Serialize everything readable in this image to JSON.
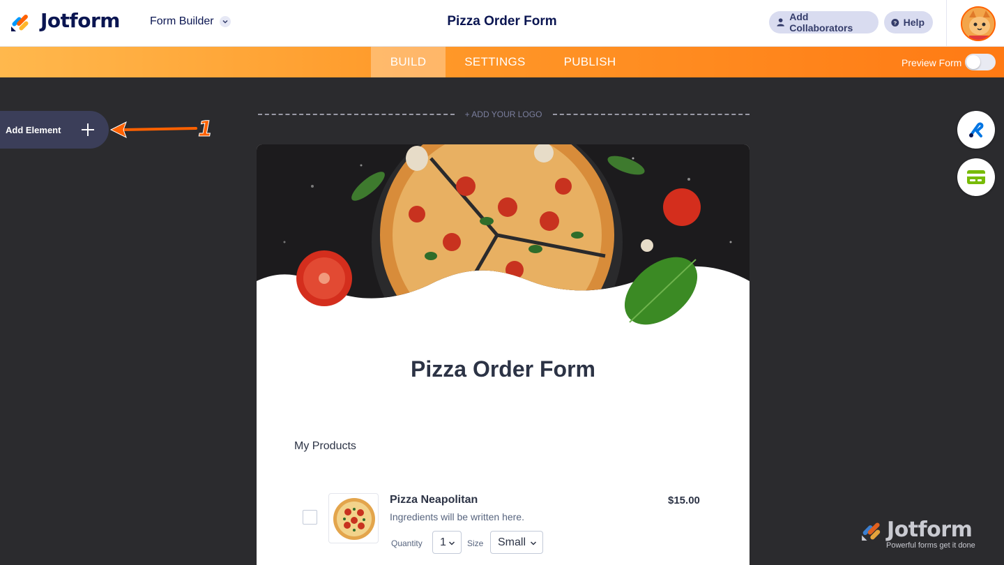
{
  "header": {
    "brand": "Jotform",
    "builder_menu": "Form Builder",
    "form_title": "Pizza Order Form",
    "add_collaborators": "Add Collaborators",
    "help": "Help"
  },
  "nav": {
    "tabs": [
      {
        "label": "BUILD",
        "active": true
      },
      {
        "label": "SETTINGS",
        "active": false
      },
      {
        "label": "PUBLISH",
        "active": false
      }
    ],
    "preview_label": "Preview Form",
    "preview_on": false
  },
  "sidebar": {
    "add_element": "Add Element",
    "annotation_number": "1"
  },
  "form": {
    "add_logo": "+ ADD YOUR LOGO",
    "title": "Pizza Order Form",
    "section_label": "My Products",
    "product": {
      "name": "Pizza Neapolitan",
      "description": "Ingredients will be written here.",
      "price": "$15.00",
      "quantity_label": "Quantity",
      "quantity_value": "1",
      "size_label": "Size",
      "size_value": "Small"
    }
  },
  "watermark": {
    "brand": "Jotform",
    "tagline": "Powerful forms get it done"
  },
  "colors": {
    "brand_navy": "#0a1551",
    "accent_orange": "#ff6100",
    "canvas_dark": "#2b2b2e",
    "tab_panel": "#3b3e59"
  },
  "icons": [
    "jotform-logo-icon",
    "chevron-down-icon",
    "user-icon",
    "question-icon",
    "plus-icon",
    "arrow-icon",
    "paint-roller-icon",
    "payment-card-icon"
  ]
}
